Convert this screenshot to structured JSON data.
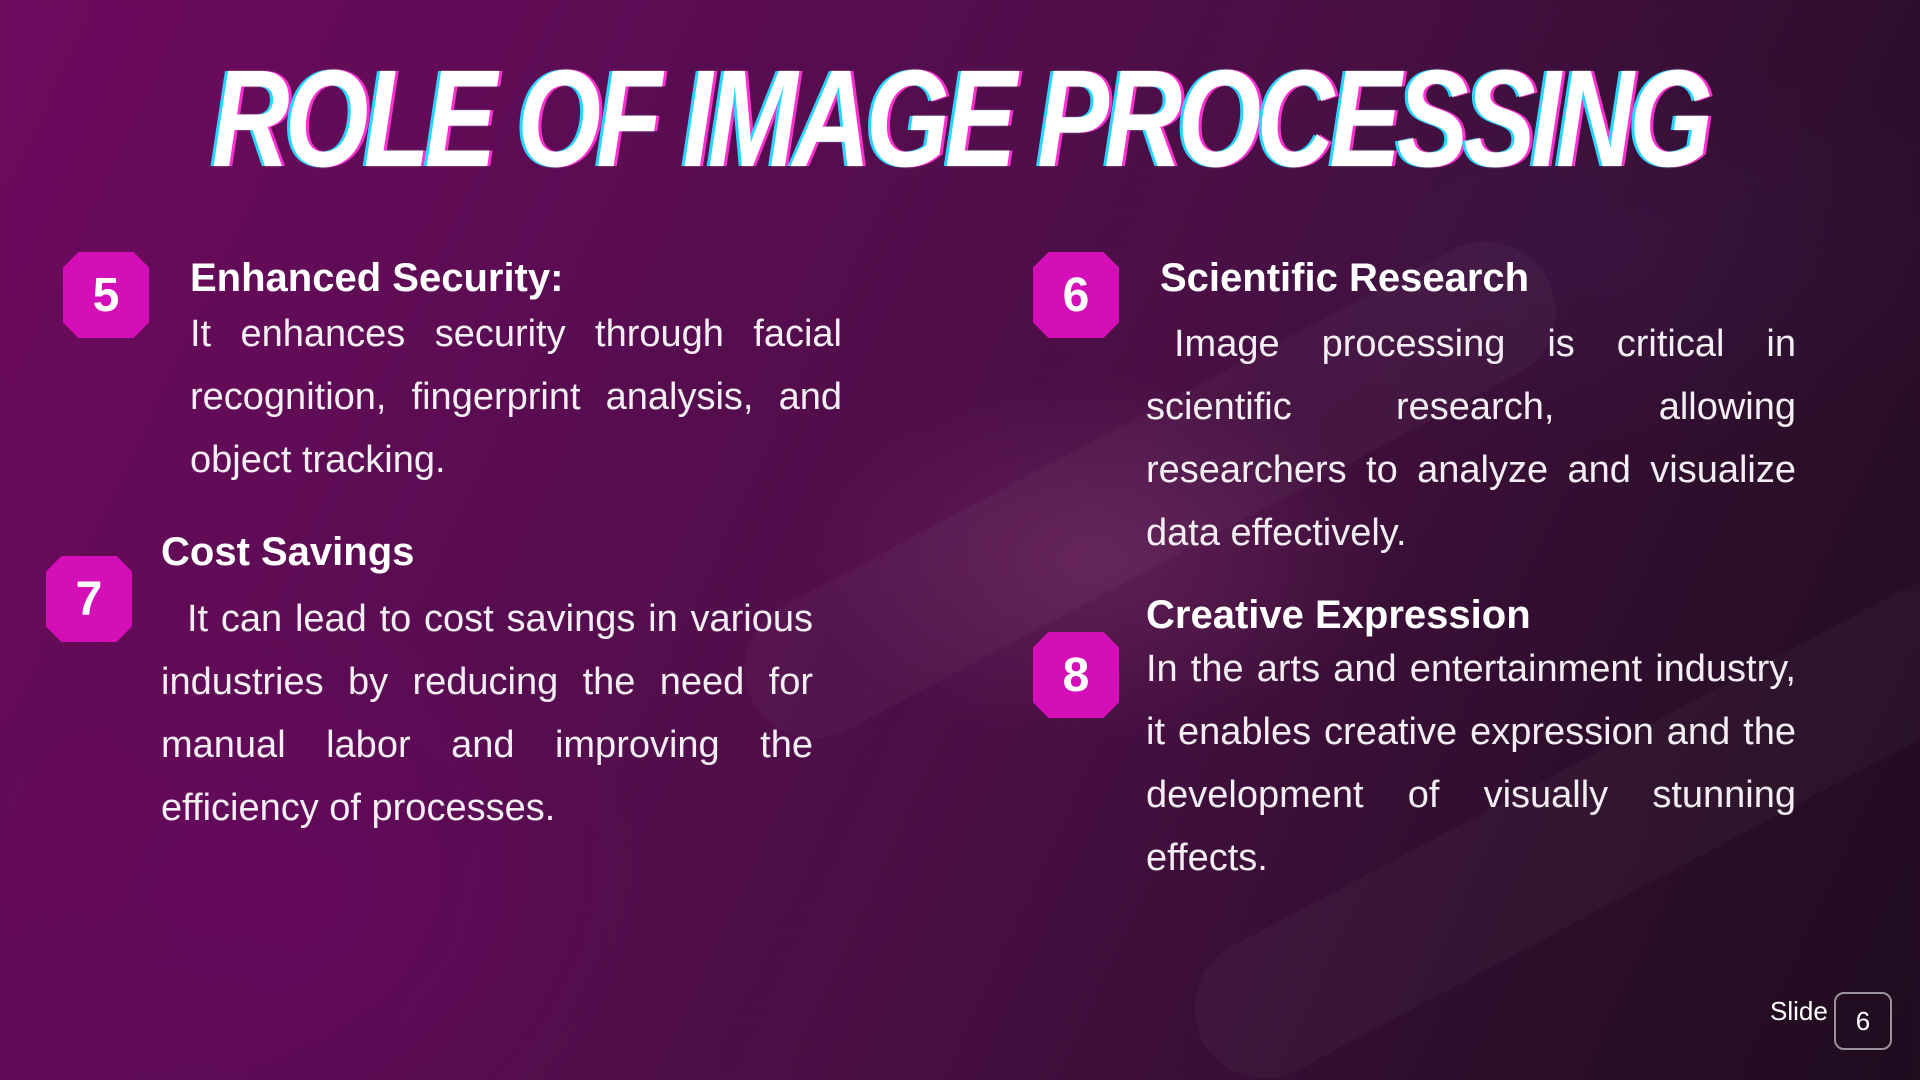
{
  "slide": {
    "title": "ROLE OF IMAGE PROCESSING",
    "items": [
      {
        "number": "5",
        "heading": "Enhanced Security:",
        "text": "It enhances security through facial recognition, fingerprint analysis, and object tracking."
      },
      {
        "number": "6",
        "heading": "Scientific Research",
        "text": "Image processing is critical in scientific research, allowing researchers to analyze and visualize data effectively."
      },
      {
        "number": "7",
        "heading": "Cost Savings",
        "text": "It can lead to cost savings in various industries by reducing the need for manual labor and improving the efficiency of processes."
      },
      {
        "number": "8",
        "heading": "Creative Expression",
        "text": "In the arts and entertainment industry, it enables creative expression and the development of visually stunning effects."
      }
    ],
    "footer": {
      "label": "Slide",
      "page_number": "6"
    }
  },
  "colors": {
    "badge": "#d40fb8",
    "background_start": "#6e0a5e",
    "background_end": "#1f0c1f",
    "title_shadow_cyan": "#27d6ff",
    "title_shadow_magenta": "#ff2fd1"
  }
}
